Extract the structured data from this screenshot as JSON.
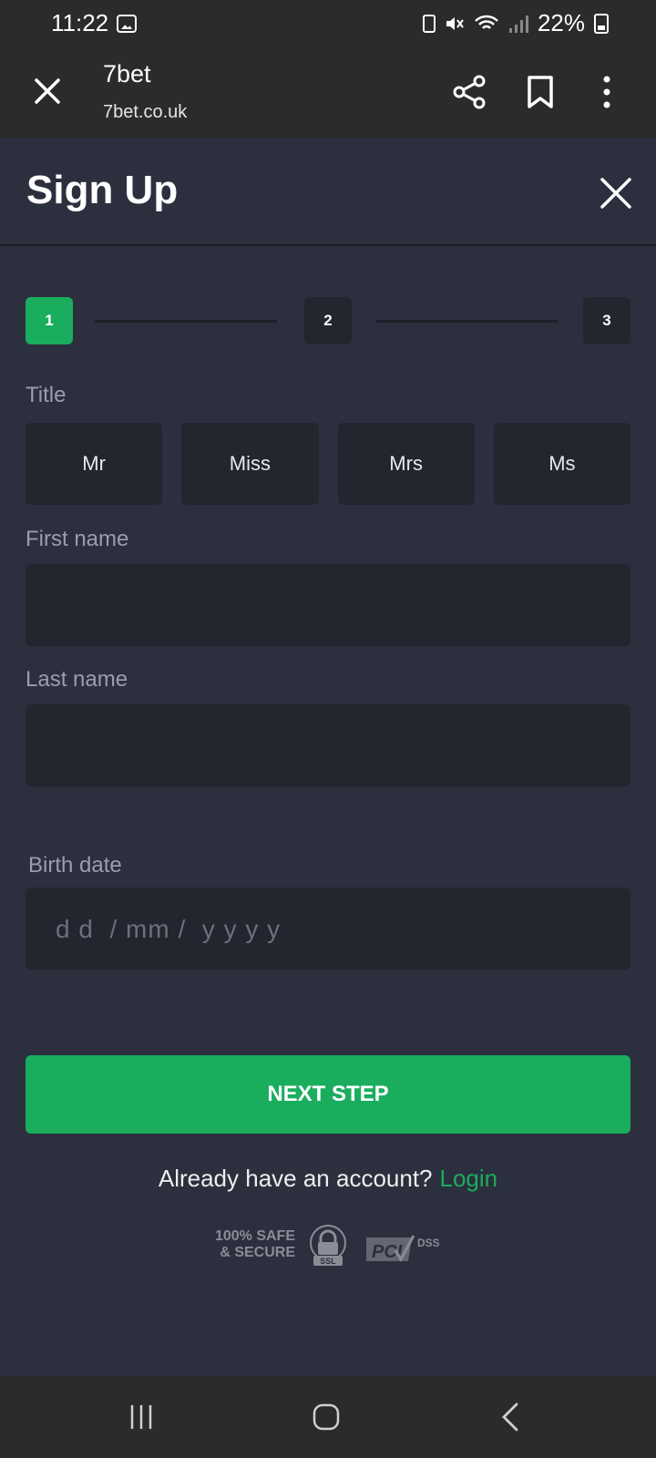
{
  "status": {
    "time": "11:22",
    "battery": "22%"
  },
  "browser": {
    "title": "7bet",
    "url": "7bet.co.uk"
  },
  "page": {
    "title": "Sign Up"
  },
  "stepper": {
    "steps": [
      "1",
      "2",
      "3"
    ],
    "active": 1
  },
  "form": {
    "title_label": "Title",
    "title_options": [
      "Mr",
      "Miss",
      "Mrs",
      "Ms"
    ],
    "first_name_label": "First name",
    "first_name_value": "",
    "last_name_label": "Last name",
    "last_name_value": "",
    "birth_date_label": "Birth date",
    "birth_date_placeholder": "d d  / mm /  y y y y"
  },
  "actions": {
    "next_label": "NEXT STEP",
    "login_prompt": "Already have an account?",
    "login_link": "Login"
  },
  "badges": {
    "secure_line1": "100% SAFE",
    "secure_line2": "& SECURE",
    "ssl": "SSL",
    "pci": "PCI",
    "dss": "DSS"
  },
  "colors": {
    "accent": "#1aad5e",
    "background": "#2c2f3d",
    "field": "#23252f",
    "chrome": "#2b2b2b"
  }
}
